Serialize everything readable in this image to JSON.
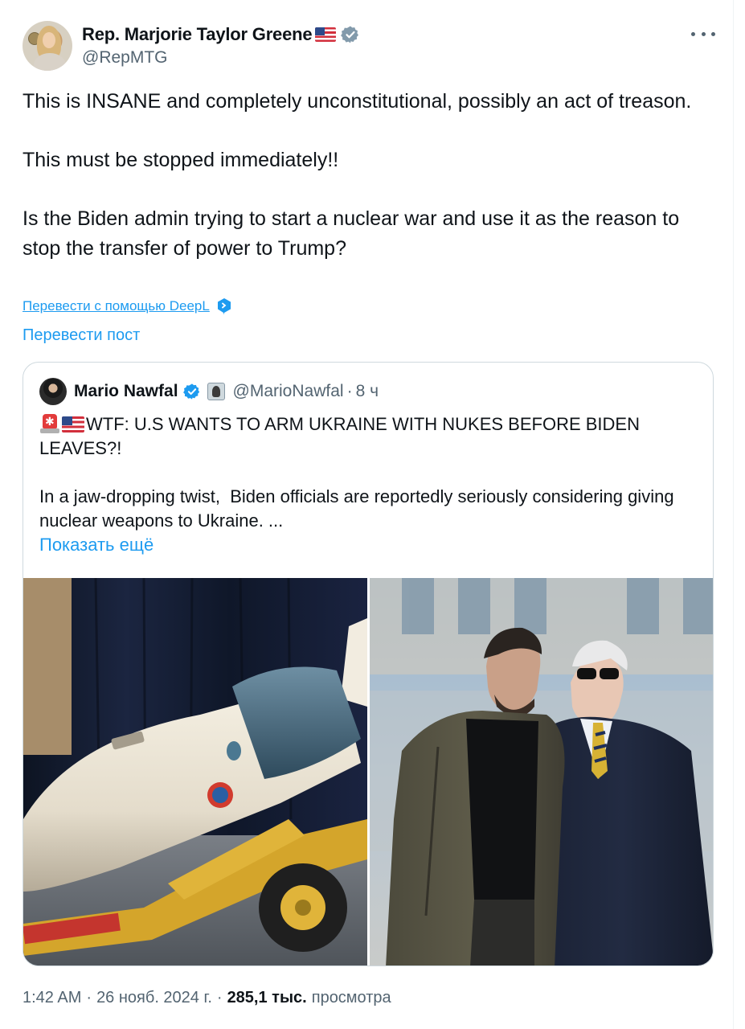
{
  "author": {
    "display_name": "Rep. Marjorie Taylor Greene",
    "handle": "@RepMTG",
    "flag_icon": "us-flag-icon",
    "verified": true
  },
  "post": {
    "text": "This is INSANE and completely unconstitutional, possibly an act of treason.\n\nThis must be stopped immediately!!\n\nIs the Biden admin trying to start a nuclear war and use it as the reason to stop the transfer of power to Trump?",
    "deepl_link": "Перевести с помощью DeepL",
    "translate_link": "Перевести пост"
  },
  "quote": {
    "display_name": "Mario Nawfal",
    "handle": "@MarioNawfal",
    "separator": "·",
    "time": "8 ч",
    "headline": "WTF: U.S WANTS TO ARM UKRAINE WITH NUKES BEFORE BIDEN LEAVES?!",
    "body": "In a jaw-dropping twist,  Biden officials are reportedly seriously considering giving nuclear weapons to Ukraine. ...",
    "show_more": "Показать ещё",
    "images": [
      "nuclear-bomb-photo",
      "zelensky-biden-photo"
    ]
  },
  "footer": {
    "time": "1:42 AM",
    "separator1": "·",
    "date": "26 нояб. 2024 г.",
    "separator2": "·",
    "views": "285,1 тыс.",
    "views_label": "просмотра"
  },
  "colors": {
    "link": "#1d9bf0",
    "secondary_text": "#536471",
    "border": "#cfd9de"
  }
}
